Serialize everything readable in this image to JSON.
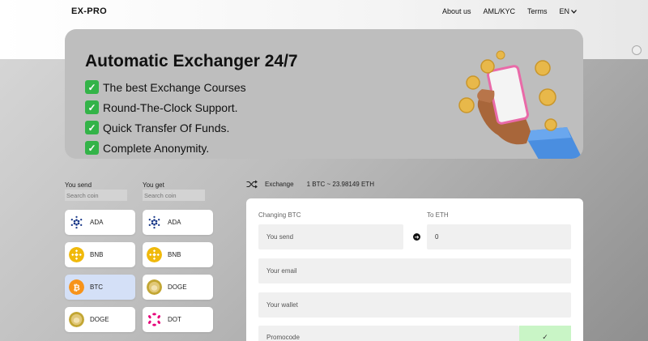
{
  "header": {
    "logo": "EX-PRO",
    "nav": [
      "About us",
      "AML/KYC",
      "Terms"
    ],
    "lang": "EN"
  },
  "hero": {
    "title": "Automatic Exchanger 24/7",
    "features": [
      "The best Exchange Courses",
      "Round-The-Clock Support.",
      "Quick Transfer Of Funds.",
      "Complete Anonymity."
    ]
  },
  "send": {
    "label": "You send",
    "search_placeholder": "Search coin",
    "coins": [
      {
        "name": "ADA",
        "color": "#1b3a8a"
      },
      {
        "name": "BNB",
        "color": "#f0b90b"
      },
      {
        "name": "BTC",
        "color": "#f7931a"
      },
      {
        "name": "DOGE",
        "color": "#c2a633"
      }
    ]
  },
  "get": {
    "label": "You get",
    "search_placeholder": "Search coin",
    "coins": [
      {
        "name": "ADA",
        "color": "#1b3a8a"
      },
      {
        "name": "BNB",
        "color": "#f0b90b"
      },
      {
        "name": "DOGE",
        "color": "#c2a633"
      },
      {
        "name": "DOT",
        "color": "#e6007a"
      }
    ]
  },
  "exchange": {
    "label": "Exchange",
    "rate": "1 BTC ~ 23.98149 ETH"
  },
  "form": {
    "changing_label": "Changing BTC",
    "to_label": "To ETH",
    "send_placeholder": "You send",
    "to_value": "0",
    "email_placeholder": "Your email",
    "wallet_placeholder": "Your wallet",
    "promo_placeholder": "Promocode",
    "promo_button": "✓"
  },
  "colors": {
    "active_coin_bg": "#d4e0f7",
    "promo_button_bg": "#c9f5c6",
    "check_green": "#33b348"
  }
}
